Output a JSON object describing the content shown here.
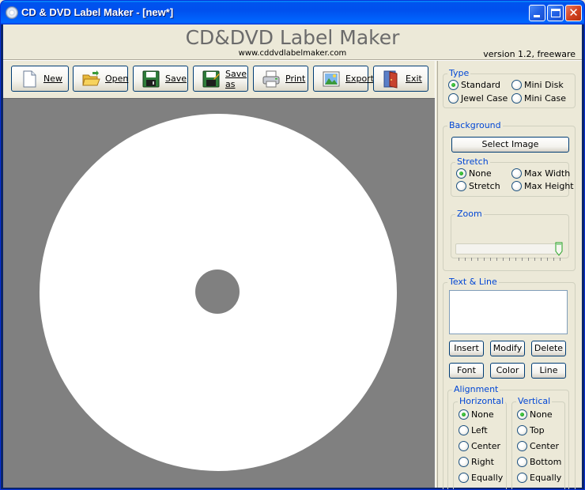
{
  "window": {
    "title": "CD & DVD Label Maker - [new*]"
  },
  "header": {
    "app_name": "CD&DVD Label Maker",
    "url": "www.cddvdlabelmaker.com",
    "version": "version 1.2, freeware"
  },
  "toolbar": {
    "new": "New",
    "open": "Open",
    "save": "Save",
    "save_as": "Save as",
    "print": "Print",
    "export": "Export",
    "exit": "Exit"
  },
  "type_group": {
    "title": "Type",
    "standard": "Standard",
    "mini_disk": "Mini Disk",
    "jewel_case": "Jewel Case",
    "mini_case": "Mini Case",
    "selected": "Standard"
  },
  "background_group": {
    "title": "Background",
    "select_image": "Select Image",
    "stretch_title": "Stretch",
    "none": "None",
    "max_width": "Max Width",
    "stretch": "Stretch",
    "max_height": "Max Height",
    "selected": "None",
    "zoom_title": "Zoom",
    "zoom_level": 1.0
  },
  "text_line_group": {
    "title": "Text & Line",
    "text_value": "",
    "insert": "Insert",
    "modify": "Modify",
    "delete": "Delete",
    "font": "Font",
    "color": "Color",
    "line": "Line"
  },
  "alignment_group": {
    "title": "Alignment",
    "horizontal": {
      "title": "Horizontal",
      "options": [
        "None",
        "Left",
        "Center",
        "Right",
        "Equally"
      ],
      "selected": "None"
    },
    "vertical": {
      "title": "Vertical",
      "options": [
        "None",
        "Top",
        "Center",
        "Bottom",
        "Equally"
      ],
      "selected": "None"
    }
  },
  "colors": {
    "canvas_background": "#808080",
    "disc": "#ffffff",
    "group_title": "#0046d5",
    "radio_checked": "#21a121"
  }
}
